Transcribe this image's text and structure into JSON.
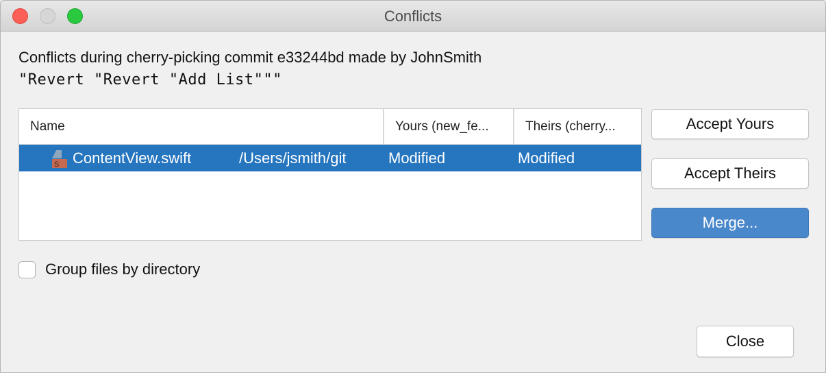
{
  "window": {
    "title": "Conflicts",
    "traffic_lights": [
      "close",
      "minimize",
      "zoom"
    ]
  },
  "message": {
    "line1": "Conflicts during cherry-picking commit e33244bd made by JohnSmith",
    "line2": "\"Revert \"Revert \"Add List\"\"\""
  },
  "table": {
    "columns": [
      "Name",
      "Yours (new_fe...",
      "Theirs (cherry..."
    ],
    "rows": [
      {
        "icon": "swift-file-icon",
        "name": "ContentView.swift",
        "path": "/Users/jsmith/git",
        "yours": "Modified",
        "theirs": "Modified",
        "selected": true
      }
    ]
  },
  "buttons": {
    "accept_yours": "Accept Yours",
    "accept_theirs": "Accept Theirs",
    "merge": "Merge...",
    "close": "Close"
  },
  "options": {
    "group_by_directory_label": "Group files by directory",
    "group_by_directory_checked": false
  },
  "colors": {
    "selection": "#2675bf",
    "primary_button": "#4a88cc"
  }
}
